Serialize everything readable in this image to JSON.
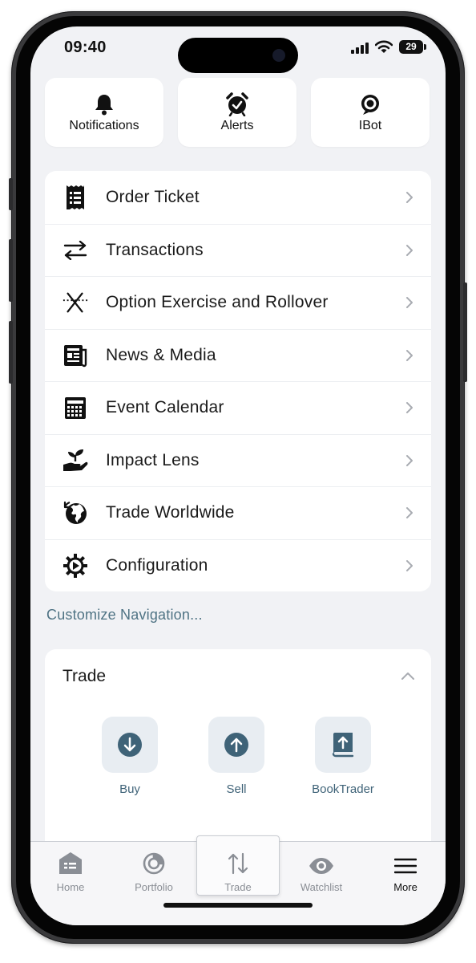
{
  "status_bar": {
    "time": "09:40",
    "battery": "29"
  },
  "quick_actions": [
    {
      "label": "Notifications",
      "icon": "bell-icon"
    },
    {
      "label": "Alerts",
      "icon": "alarm-clock-icon"
    },
    {
      "label": "IBot",
      "icon": "ibot-icon"
    }
  ],
  "menu": {
    "items": [
      {
        "label": "Order Ticket",
        "icon": "order-ticket-icon"
      },
      {
        "label": "Transactions",
        "icon": "transfer-arrows-icon"
      },
      {
        "label": "Option Exercise and Rollover",
        "icon": "option-exercise-icon"
      },
      {
        "label": "News & Media",
        "icon": "newspaper-icon"
      },
      {
        "label": "Event Calendar",
        "icon": "calendar-icon"
      },
      {
        "label": "Impact Lens",
        "icon": "plant-hand-icon"
      },
      {
        "label": "Trade Worldwide",
        "icon": "globe-icon"
      },
      {
        "label": "Configuration",
        "icon": "gear-icon"
      }
    ]
  },
  "customize_link": "Customize Navigation...",
  "trade": {
    "title": "Trade",
    "actions": [
      {
        "label": "Buy",
        "icon": "arrow-down-circle-icon"
      },
      {
        "label": "Sell",
        "icon": "arrow-up-circle-icon"
      },
      {
        "label": "BookTrader",
        "icon": "book-upload-icon"
      }
    ]
  },
  "tab_bar": {
    "tabs": [
      {
        "label": "Home",
        "icon": "home-icon"
      },
      {
        "label": "Portfolio",
        "icon": "portfolio-icon"
      },
      {
        "label": "Trade",
        "icon": "trade-arrows-icon"
      },
      {
        "label": "Watchlist",
        "icon": "eye-icon"
      },
      {
        "label": "More",
        "icon": "hamburger-icon"
      }
    ],
    "selected": "More"
  },
  "colors": {
    "accent": "#4f7384",
    "trade_icon": "#3f6378",
    "background": "#f1f2f5"
  }
}
